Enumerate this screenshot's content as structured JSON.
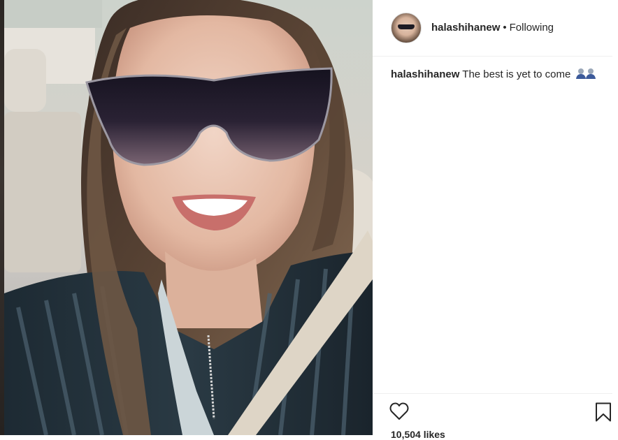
{
  "post": {
    "username": "halashihanew",
    "separator": "•",
    "follow_status": "Following",
    "caption_user": "halashihanew",
    "caption_text": "The best is yet to come",
    "caption_emoji": "two-people-icon",
    "likes": "10,504 likes"
  },
  "icons": {
    "like": "heart-outline-icon",
    "save": "bookmark-outline-icon"
  },
  "colors": {
    "text": "#262626",
    "divider": "#efefef"
  }
}
